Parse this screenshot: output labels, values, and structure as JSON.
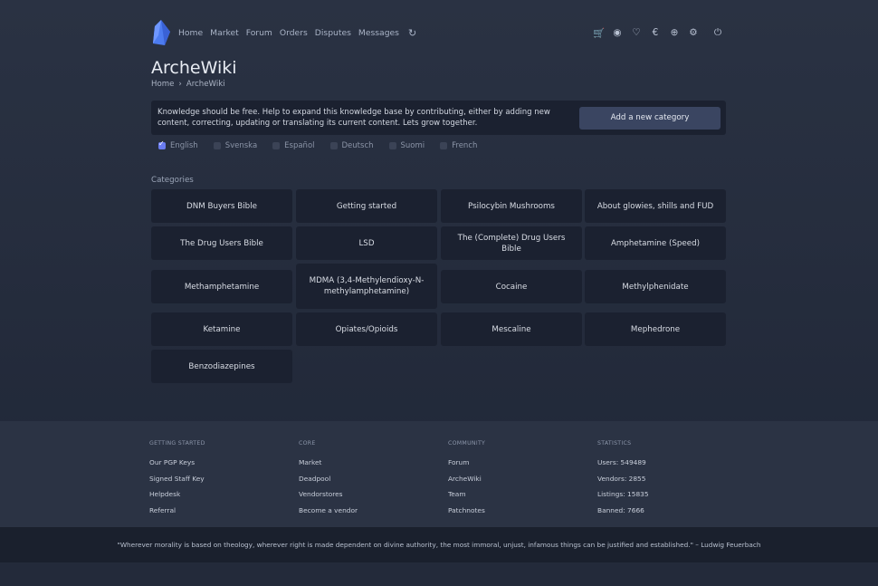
{
  "nav": {
    "items": [
      "Home",
      "Market",
      "Forum",
      "Orders",
      "Disputes",
      "Messages"
    ],
    "refresh_icon": "↻"
  },
  "header_icons": [
    {
      "name": "cart-icon",
      "glyph": "🛒"
    },
    {
      "name": "user-icon",
      "glyph": "◉"
    },
    {
      "name": "heart-icon",
      "glyph": "♡"
    },
    {
      "name": "currency-icon",
      "glyph": "€"
    },
    {
      "name": "support-icon",
      "glyph": "⊕"
    },
    {
      "name": "settings-icon",
      "glyph": "⚙"
    },
    {
      "name": "power-icon",
      "glyph": "⏻"
    }
  ],
  "page": {
    "title": "ArcheWiki",
    "breadcrumb": [
      "Home",
      "›",
      "ArcheWiki"
    ]
  },
  "notice": {
    "text": "Knowledge should be free. Help to expand this knowledge base by contributing, either by adding new content, correcting, updating or translating its current content. Lets grow together.",
    "button": "Add a new category"
  },
  "languages": [
    {
      "label": "English",
      "checked": true
    },
    {
      "label": "Svenska",
      "checked": false
    },
    {
      "label": "Español",
      "checked": false
    },
    {
      "label": "Deutsch",
      "checked": false
    },
    {
      "label": "Suomi",
      "checked": false
    },
    {
      "label": "French",
      "checked": false
    }
  ],
  "categories_label": "Categories",
  "categories": [
    "DNM Buyers Bible",
    "Getting started",
    "Psilocybin Mushrooms",
    "About glowies, shills and FUD",
    "The Drug Users Bible",
    "LSD",
    "The (Complete) Drug Users Bible",
    "Amphetamine (Speed)",
    "Methamphetamine",
    "MDMA (3,4-Methylendioxy-N-methylamphetamine)",
    "Cocaine",
    "Methylphenidate",
    "Ketamine",
    "Opiates/Opioids",
    "Mescaline",
    "Mephedrone",
    "Benzodiazepines"
  ],
  "footer": {
    "columns": [
      {
        "heading": "GETTING STARTED",
        "links": [
          "Our PGP Keys",
          "Signed Staff Key",
          "Helpdesk",
          "Referral"
        ]
      },
      {
        "heading": "CORE",
        "links": [
          "Market",
          "Deadpool",
          "Vendorstores",
          "Become a vendor"
        ]
      },
      {
        "heading": "COMMUNITY",
        "links": [
          "Forum",
          "ArcheWiki",
          "Team",
          "Patchnotes"
        ]
      },
      {
        "heading": "STATISTICS",
        "links": [
          "Users: 549489",
          "Vendors: 2855",
          "Listings: 15835",
          "Banned: 7666"
        ]
      }
    ],
    "quote": "\"Wherever morality is based on theology, wherever right is made dependent on divine authority, the most immoral, unjust, infamous things can be justified and established.\" – Ludwig Feuerbach"
  }
}
